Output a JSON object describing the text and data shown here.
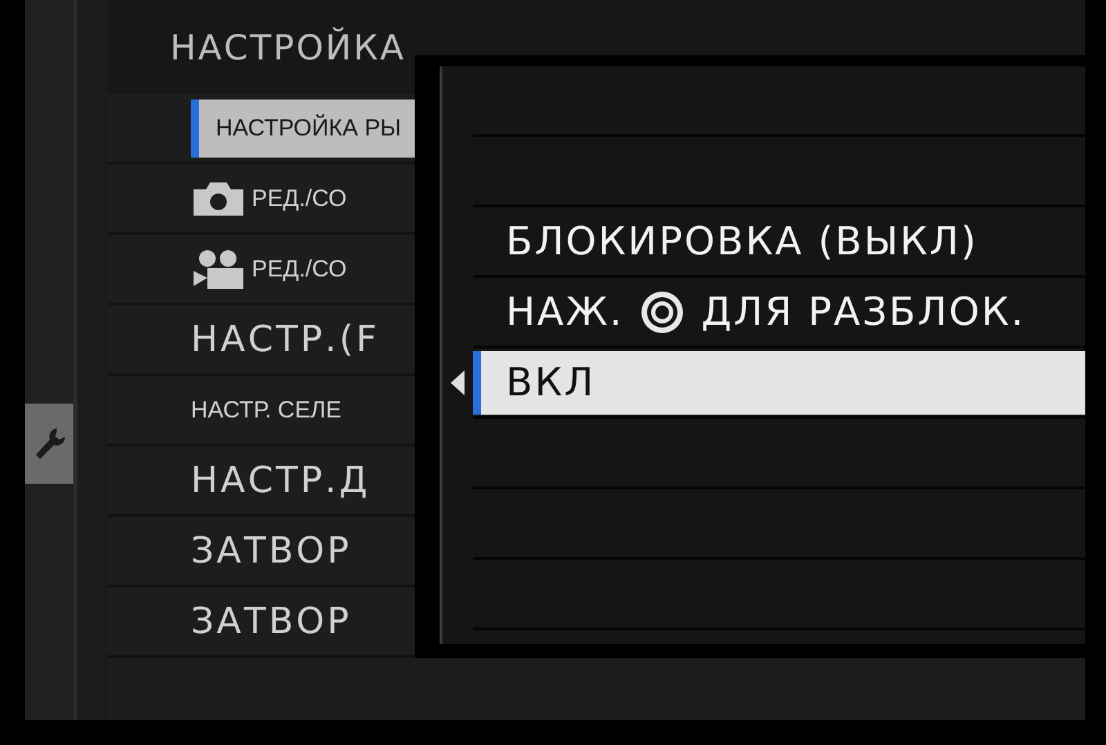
{
  "side_tab": {
    "selected": true
  },
  "header": "НАСТРОЙКА",
  "menu": [
    {
      "label": "НАСТРОЙКА РЫ",
      "kind": "compact",
      "selected": true
    },
    {
      "label": "РЕД./СО",
      "kind": "photo",
      "selected": false
    },
    {
      "label": "РЕД./СО",
      "kind": "video",
      "selected": false
    },
    {
      "label": "НАСТР.(F",
      "kind": "text",
      "selected": false
    },
    {
      "label": "НАСТР. СЕЛЕ",
      "kind": "compact",
      "selected": false
    },
    {
      "label": "НАСТР.Д",
      "kind": "text",
      "selected": false
    },
    {
      "label": "ЗАТВОР",
      "kind": "text",
      "selected": false
    },
    {
      "label": "ЗАТВОР",
      "kind": "text",
      "selected": false
    }
  ],
  "popup": {
    "options": [
      {
        "kind": "empty"
      },
      {
        "kind": "empty"
      },
      {
        "kind": "text",
        "label": "БЛОКИРОВКА (ВЫКЛ)",
        "selected": false
      },
      {
        "kind": "dial",
        "label": "НАЖ.",
        "label_after": "ДЛЯ РАЗБЛОК.",
        "selected": false
      },
      {
        "kind": "text",
        "label": "ВКЛ",
        "selected": true
      },
      {
        "kind": "empty"
      },
      {
        "kind": "empty"
      },
      {
        "kind": "empty"
      }
    ]
  }
}
